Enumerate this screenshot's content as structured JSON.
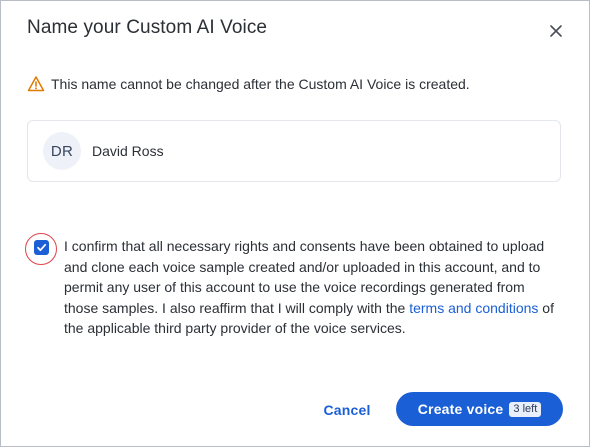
{
  "dialog": {
    "title": "Name your Custom AI Voice",
    "close_icon": "close-icon"
  },
  "warning": {
    "icon": "warning-triangle-icon",
    "color": "#e07b00",
    "text": "This name cannot be changed after the Custom AI Voice is created."
  },
  "user": {
    "initials": "DR",
    "name": "David Ross"
  },
  "consent": {
    "checked": true,
    "text_before": "I confirm that all necessary rights and consents have been obtained to upload and clone each voice sample created and/or uploaded in this account, and to permit any user of this account to use the voice recordings generated from those samples. I also reaffirm that I will comply with the ",
    "link_text": "terms and conditions",
    "text_after": " of the applicable third party provider of the voice services."
  },
  "actions": {
    "cancel_label": "Cancel",
    "create_label": "Create voice",
    "remaining_badge": "3 left"
  },
  "colors": {
    "primary": "#1a5fd6",
    "highlight_ring": "#e0454c"
  }
}
